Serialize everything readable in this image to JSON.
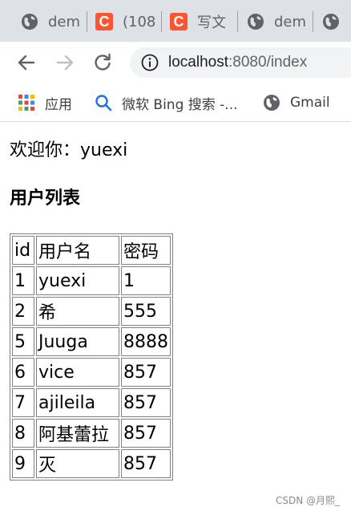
{
  "browser": {
    "tabs": [
      {
        "title": "dem",
        "favicon": "globe-icon"
      },
      {
        "title": "(108",
        "favicon": "csdn-c-icon"
      },
      {
        "title": "写文",
        "favicon": "csdn-c-icon"
      },
      {
        "title": "dem",
        "favicon": "globe-icon"
      },
      {
        "title": "",
        "favicon": "globe-icon"
      }
    ],
    "csdn_letter": "C",
    "address": {
      "host": "localhost",
      "rest": ":8080/index"
    },
    "bookmarks": [
      {
        "label": "应用",
        "icon": "apps-grid-icon"
      },
      {
        "label": "微软 Bing 搜索 -...",
        "icon": "search-icon"
      },
      {
        "label": "Gmail",
        "icon": "globe-icon"
      }
    ]
  },
  "page": {
    "welcome": "欢迎你：yuexi",
    "section_title": "用户列表",
    "table": {
      "headers": [
        "id",
        "用户名",
        "密码"
      ],
      "rows": [
        [
          "1",
          "yuexi",
          "1"
        ],
        [
          "2",
          "希",
          "555"
        ],
        [
          "5",
          "Juuga",
          "8888"
        ],
        [
          "6",
          "vice",
          "857"
        ],
        [
          "7",
          "ajileila",
          "857"
        ],
        [
          "8",
          "阿基蕾拉",
          "857"
        ],
        [
          "9",
          "灭",
          "857"
        ]
      ]
    },
    "watermark": "CSDN @月熙_"
  },
  "colors": {
    "tabstrip_bg": "#dee1e6",
    "csdn_brand": "#fc5531",
    "omnibox_bg": "#f1f3f4",
    "icon_gray": "#5f6368"
  }
}
